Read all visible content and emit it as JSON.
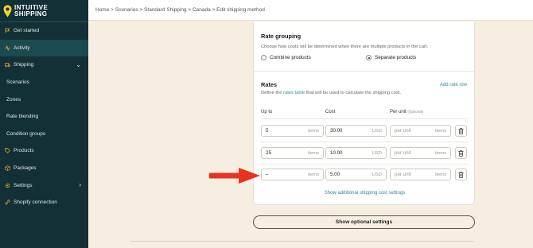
{
  "brand": {
    "line1": "INTUITIVE",
    "line2": "SHIPPING"
  },
  "breadcrumb": "Home > Scenarios > Standard Shipping > Canada > Edit shipping method",
  "sidebar": {
    "items": [
      {
        "label": "Get started",
        "icon": "flag-icon"
      },
      {
        "label": "Activity",
        "icon": "activity-icon"
      },
      {
        "label": "Shipping",
        "icon": "truck-icon"
      },
      {
        "label": "Scenarios"
      },
      {
        "label": "Zones"
      },
      {
        "label": "Rate blending"
      },
      {
        "label": "Condition groups"
      },
      {
        "label": "Products",
        "icon": "tag-icon"
      },
      {
        "label": "Packages",
        "icon": "package-icon"
      },
      {
        "label": "Settings",
        "icon": "gear-icon"
      },
      {
        "label": "Shopify connection",
        "icon": "link-icon"
      }
    ]
  },
  "rate_grouping": {
    "title": "Rate grouping",
    "description": "Choose how costs will be determined when there are multiple products in the cart.",
    "options": [
      "Combine products",
      "Separate products"
    ],
    "selected": "Separate products"
  },
  "rates": {
    "title": "Rates",
    "desc_before": "Define the ",
    "desc_link": "rates table",
    "desc_after": " that will be used to calculate the shipping cost.",
    "add_rate_label": "Add rate row",
    "columns": {
      "up_to": "Up to",
      "cost": "Cost",
      "per_unit": "Per unit",
      "per_unit_note": "(Optional)"
    },
    "rows": [
      {
        "up_to": "5",
        "up_to_unit": "items",
        "cost": "30.00",
        "currency": "USD",
        "per_unit_placeholder": "per unit",
        "per_unit_unit": "items"
      },
      {
        "up_to": "25",
        "up_to_unit": "items",
        "cost": "10.00",
        "currency": "USD",
        "per_unit_placeholder": "per unit",
        "per_unit_unit": "items"
      },
      {
        "up_to": "–",
        "up_to_unit": "items",
        "cost": "5.00",
        "currency": "USD",
        "per_unit_placeholder": "per unit",
        "per_unit_unit": "items"
      }
    ],
    "show_additional_label": "Show additional shipping cost settings"
  },
  "optional_settings_button": "Show optional settings",
  "colors": {
    "sidebar_bg": "#123036",
    "accent": "#2a8a99",
    "page_bg": "#f6efe1",
    "arrow": "#e8331f",
    "brand_pin": "#f3cf2f"
  }
}
